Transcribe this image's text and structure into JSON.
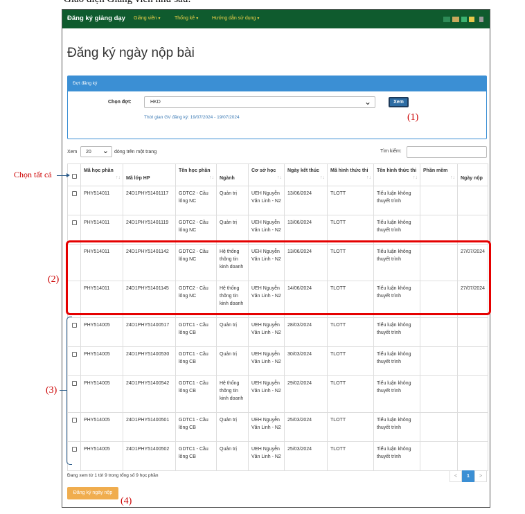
{
  "doc_caption": "Giao diện Giảng viên như sau:",
  "navbar": {
    "brand": "Đăng ký giảng dạy",
    "menu": [
      "Giảng viên",
      "Thống kê",
      "Hướng dẫn sử dụng"
    ],
    "user_block_colors": [
      "#2e8b57",
      "#c8a95c",
      "#3cb371",
      "#e6c84a",
      "#999999"
    ]
  },
  "page_title": "Đăng ký ngày nộp bài",
  "panel": {
    "heading": "Đợt đăng ký",
    "select_label": "Chọn đợt:",
    "select_value": "HKD",
    "view_button": "Xem",
    "period_text": "Thời gian GV đăng ký: 19/07/2024 - 19/07/2024"
  },
  "table_controls": {
    "show_label": "Xem",
    "page_length": "20",
    "show_suffix": "dòng trên một trang",
    "search_label": "Tìm kiếm:",
    "search_value": ""
  },
  "columns": [
    "",
    "Mã học phần",
    "Mã lớp HP",
    "Tên học phần",
    "Ngành",
    "Cơ sở học",
    "Ngày kết thúc",
    "Mã hình thức thi",
    "Tên hình thức thi",
    "Phần mềm",
    "Ngày nộp"
  ],
  "rows": [
    {
      "checkbox": true,
      "ma_hp": "PHY514011",
      "ma_lop": "24D1PHY51401117",
      "ten_hp": "GDTC2 - Cầu lông NC",
      "nganh": "Quản trị",
      "co_so": "UEH Nguyễn Văn Linh - N2",
      "ngay_kt": "13/06/2024",
      "ma_ht": "TLOTT",
      "ten_ht": "Tiểu luận không thuyết trình",
      "phan_mem": "",
      "ngay_nop": ""
    },
    {
      "checkbox": true,
      "ma_hp": "PHY514011",
      "ma_lop": "24D1PHY51401119",
      "ten_hp": "GDTC2 - Cầu lông NC",
      "nganh": "Quản trị",
      "co_so": "UEH Nguyễn Văn Linh - N2",
      "ngay_kt": "13/06/2024",
      "ma_ht": "TLOTT",
      "ten_ht": "Tiểu luận không thuyết trình",
      "phan_mem": "",
      "ngay_nop": ""
    },
    {
      "checkbox": false,
      "ma_hp": "PHY514011",
      "ma_lop": "24D1PHY51401142",
      "ten_hp": "GDTC2 - Cầu lông NC",
      "nganh": "Hệ thống thông tin kinh doanh",
      "co_so": "UEH Nguyễn Văn Linh - N2",
      "ngay_kt": "13/06/2024",
      "ma_ht": "TLOTT",
      "ten_ht": "Tiểu luận không thuyết trình",
      "phan_mem": "",
      "ngay_nop": "27/07/2024"
    },
    {
      "checkbox": false,
      "ma_hp": "PHY514011",
      "ma_lop": "24D1PHY51401145",
      "ten_hp": "GDTC2 - Cầu lông NC",
      "nganh": "Hệ thống thông tin kinh doanh",
      "co_so": "UEH Nguyễn Văn Linh - N2",
      "ngay_kt": "14/06/2024",
      "ma_ht": "TLOTT",
      "ten_ht": "Tiểu luận không thuyết trình",
      "phan_mem": "",
      "ngay_nop": "27/07/2024"
    },
    {
      "checkbox": true,
      "ma_hp": "PHY514005",
      "ma_lop": "24D1PHY51400517",
      "ten_hp": "GDTC1 - Cầu lông CB",
      "nganh": "Quản trị",
      "co_so": "UEH Nguyễn Văn Linh - N2",
      "ngay_kt": "28/03/2024",
      "ma_ht": "TLOTT",
      "ten_ht": "Tiểu luận không thuyết trình",
      "phan_mem": "",
      "ngay_nop": ""
    },
    {
      "checkbox": true,
      "ma_hp": "PHY514005",
      "ma_lop": "24D1PHY51400530",
      "ten_hp": "GDTC1 - Cầu lông CB",
      "nganh": "Quản trị",
      "co_so": "UEH Nguyễn Văn Linh - N2",
      "ngay_kt": "30/03/2024",
      "ma_ht": "TLOTT",
      "ten_ht": "Tiểu luận không thuyết trình",
      "phan_mem": "",
      "ngay_nop": ""
    },
    {
      "checkbox": true,
      "ma_hp": "PHY514005",
      "ma_lop": "24D1PHY51400542",
      "ten_hp": "GDTC1 - Cầu lông CB",
      "nganh": "Hệ thống thông tin kinh doanh",
      "co_so": "UEH Nguyễn Văn Linh - N2",
      "ngay_kt": "29/02/2024",
      "ma_ht": "TLOTT",
      "ten_ht": "Tiểu luận không thuyết trình",
      "phan_mem": "",
      "ngay_nop": ""
    },
    {
      "checkbox": true,
      "ma_hp": "PHY514005",
      "ma_lop": "24D1PHY51400501",
      "ten_hp": "GDTC1 - Cầu lông CB",
      "nganh": "Quản trị",
      "co_so": "UEH Nguyễn Văn Linh - N2",
      "ngay_kt": "25/03/2024",
      "ma_ht": "TLOTT",
      "ten_ht": "Tiểu luận không thuyết trình",
      "phan_mem": "",
      "ngay_nop": ""
    },
    {
      "checkbox": true,
      "ma_hp": "PHY514005",
      "ma_lop": "24D1PHY51400502",
      "ten_hp": "GDTC1 - Cầu lông CB",
      "nganh": "Quản trị",
      "co_so": "UEH Nguyễn Văn Linh - N2",
      "ngay_kt": "25/03/2024",
      "ma_ht": "TLOTT",
      "ten_ht": "Tiểu luận không thuyết trình",
      "phan_mem": "",
      "ngay_nop": ""
    }
  ],
  "footer": {
    "info": "Đang xem từ 1 tới 9 trong tổng số 9 học phần",
    "pager": [
      "<",
      "1",
      ">"
    ],
    "register_button": "Đăng ký ngày nộp"
  },
  "annotations": {
    "select_all": "Chọn tất cả",
    "n1": "(1)",
    "n2": "(2)",
    "n3": "(3)",
    "n4": "(4)"
  },
  "colors": {
    "navbar": "#0f5b2e",
    "menu_text": "#f3d54a",
    "panel": "#3b8fd4",
    "register_button": "#f0ad4e",
    "highlight": "#e50000"
  }
}
